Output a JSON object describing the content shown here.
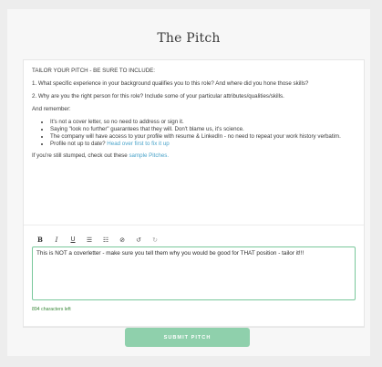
{
  "page": {
    "title": "The Pitch"
  },
  "instructions": {
    "heading": "TAILOR YOUR PITCH - BE SURE TO INCLUDE:",
    "point1": "1. What specific experience in your background qualifies you to this role? And where did you hone those skills?",
    "point2": "2. Why are you the right person for this role? Include some of your particular attributes/qualities/skills.",
    "remember_label": "And remember:",
    "bullets": {
      "b1": "It's not a cover letter, so no need to address or sign it.",
      "b2": "Saying \"look no further\" guarantees that they will. Don't blame us, it's science.",
      "b3": "The company will have access to your profile with resume & LinkedIn - no need to repeat your work history verbatim.",
      "b4_text": "Profile not up to date?",
      "b4_link": "Head over first to fix it up"
    },
    "stumped_text": "If you're still stumped, check out these",
    "stumped_link": "sample Pitches."
  },
  "editor": {
    "toolbar": {
      "bold": "B",
      "italic": "I",
      "underline": "U",
      "bullet_list": "☰",
      "numbered_list": "☷",
      "clear_format": "⊘",
      "undo": "↺",
      "redo": "↻"
    },
    "text": "This is NOT a coverletter - make sure you tell them why you would be good for THAT position - tailor it!!!",
    "chars_left": "894 characters left"
  },
  "actions": {
    "submit_label": "SUBMIT PITCH"
  },
  "colors": {
    "accent_green": "#79c89b",
    "submit_bg": "#8fd0ac",
    "link": "#4aa3c9"
  }
}
